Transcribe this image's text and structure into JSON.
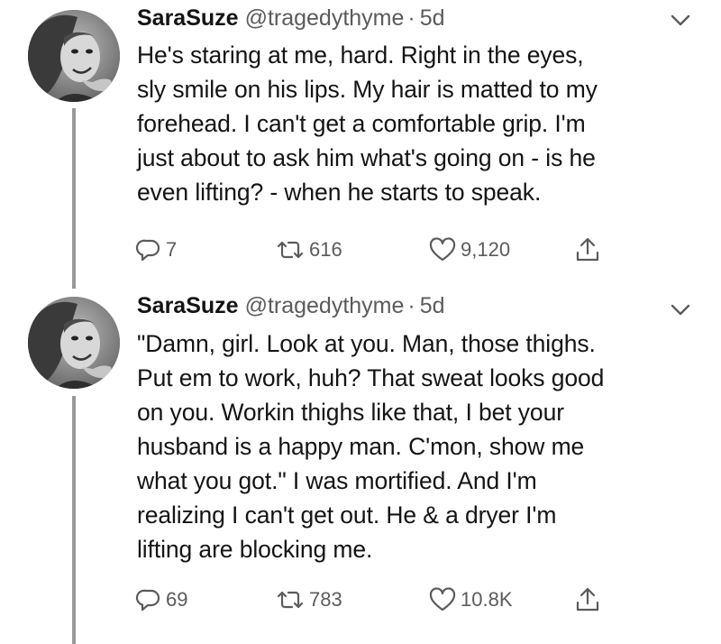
{
  "tweets": [
    {
      "display_name": "SaraSuze",
      "handle": "@tragedythyme",
      "separator": "·",
      "time": "5d",
      "text_lines": [
        "He's staring at me, hard. Right in the eyes,",
        "sly smile on his lips. My hair is matted to my",
        "forehead. I can't get a comfortable grip. I'm",
        "just about to ask him what's going on - is he",
        "even lifting? - when he starts to speak."
      ],
      "replies": "7",
      "retweets": "616",
      "likes": "9,120"
    },
    {
      "display_name": "SaraSuze",
      "handle": "@tragedythyme",
      "separator": "·",
      "time": "5d",
      "text_lines": [
        "\"Damn, girl. Look at you. Man, those thighs.",
        "Put em to work, huh? That sweat looks good",
        "on you. Workin thighs like that, I bet your",
        "husband is a happy man. C'mon, show me",
        "what you got.\" I was mortified. And I'm",
        "realizing I can't get out. He & a dryer I'm",
        "lifting are blocking me."
      ],
      "replies": "69",
      "retweets": "783",
      "likes": "10.8K"
    }
  ],
  "icons": {
    "reply": "reply-icon",
    "retweet": "retweet-icon",
    "like": "heart-icon",
    "share": "share-icon",
    "menu": "chevron-down-icon"
  },
  "colors": {
    "text": "#141414",
    "muted": "#5b5b5b",
    "thread_line": "#9a9a9a",
    "background": "#ffffff"
  }
}
